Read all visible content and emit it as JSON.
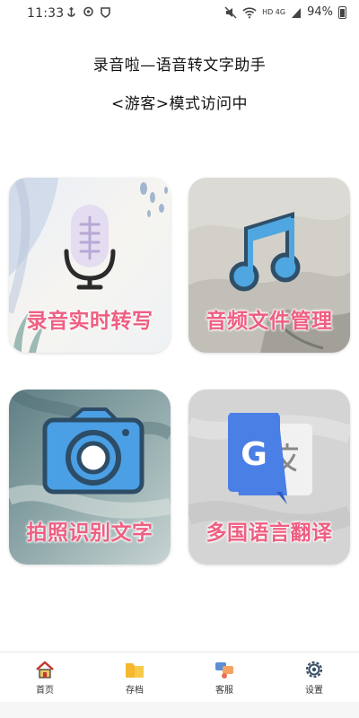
{
  "status_bar": {
    "time": "11:33",
    "battery": "94%",
    "network": "HD 4G"
  },
  "header": {
    "title": "录音啦—语音转文字助手",
    "subtitle": "<游客>模式访问中"
  },
  "cards": {
    "record": {
      "label": "录音实时转写",
      "icon": "microphone-icon"
    },
    "audio": {
      "label": "音频文件管理",
      "icon": "music-note-icon"
    },
    "photo": {
      "label": "拍照识别文字",
      "icon": "camera-icon"
    },
    "translate": {
      "label": "多国语言翻译",
      "icon": "google-translate-icon"
    }
  },
  "tabs": [
    {
      "label": "首页",
      "icon": "home-icon"
    },
    {
      "label": "存档",
      "icon": "folder-icon"
    },
    {
      "label": "客服",
      "icon": "customer-service-icon"
    },
    {
      "label": "设置",
      "icon": "gear-icon"
    }
  ],
  "colors": {
    "card_label": "#ee5f82",
    "mic_body": "#e4dcf0",
    "note_blue": "#4fa6e0",
    "camera_blue": "#4a9fe5",
    "translate_blue": "#4a7fe6"
  }
}
